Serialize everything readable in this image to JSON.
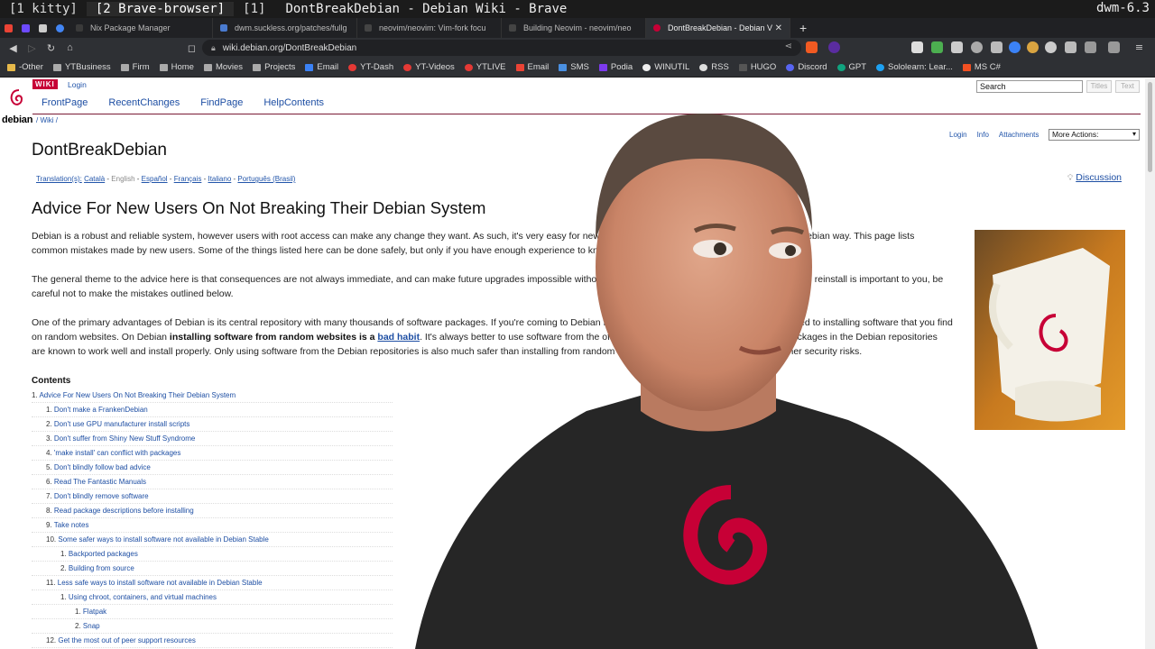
{
  "wm": {
    "tags": [
      "[1 kitty]",
      "[2 Brave-browser]",
      "[1]"
    ],
    "window_title": "DontBreakDebian - Debian Wiki - Brave",
    "status": "dwm-6.3"
  },
  "browser": {
    "tabs": [
      {
        "label": "Nix Package Manager"
      },
      {
        "label": "dwm.suckless.org/patches/fullg"
      },
      {
        "label": "neovim/neovim: Vim-fork focu"
      },
      {
        "label": "Building Neovim - neovim/neo"
      },
      {
        "label": "DontBreakDebian - Debian V",
        "active": true
      }
    ],
    "close_glyph": "✕",
    "newtab_glyph": "+",
    "url": "wiki.debian.org/DontBreakDebian",
    "shield_count": "3",
    "bookmarks": [
      {
        "label": "-Other",
        "color": "#e6b94a"
      },
      {
        "label": "YTBusiness",
        "color": "#aaaaaa"
      },
      {
        "label": "Firm",
        "color": "#aaaaaa"
      },
      {
        "label": "Home",
        "color": "#aaaaaa"
      },
      {
        "label": "Movies",
        "color": "#aaaaaa"
      },
      {
        "label": "Projects",
        "color": "#aaaaaa"
      },
      {
        "label": "Email",
        "color": "#3b82f6"
      },
      {
        "label": "YT-Dash",
        "color": "#e53935"
      },
      {
        "label": "YT-Videos",
        "color": "#e53935"
      },
      {
        "label": "YTLIVE",
        "color": "#e53935"
      },
      {
        "label": "Email",
        "color": "#ea4335"
      },
      {
        "label": "SMS",
        "color": "#4a90e2"
      },
      {
        "label": "Podia",
        "color": "#7c3aed"
      },
      {
        "label": "WINUTIL",
        "color": "#eeeeee"
      },
      {
        "label": "RSS",
        "color": "#dddddd"
      },
      {
        "label": "HUGO",
        "color": "#555555"
      },
      {
        "label": "Discord",
        "color": "#5865f2"
      },
      {
        "label": "GPT",
        "color": "#10a37f"
      },
      {
        "label": "Sololearn: Lear...",
        "color": "#1da1f2"
      },
      {
        "label": "MS C#",
        "color": "#f25022"
      }
    ]
  },
  "wiki": {
    "badge": "WIKI",
    "top_login": "Login",
    "logo_word": "debian",
    "search_placeholder": "Search",
    "titles_btn": "Titles",
    "text_btn": "Text",
    "nav": [
      "FrontPage",
      "RecentChanges",
      "FindPage",
      "HelpContents"
    ],
    "breadcrumb": "/  Wiki /",
    "actions": [
      "Login",
      "Info",
      "Attachments"
    ],
    "more_actions": "More Actions:",
    "page_title": "DontBreakDebian",
    "translations_label": "Translation(s):",
    "translations": [
      "Català",
      "English",
      "Español",
      "Français",
      "Italiano",
      "Português (Brasil)"
    ],
    "discussion": "Discussion",
    "heading": "Advice For New Users On Not Breaking Their Debian System",
    "p1a": "Debian is a robust and reliable system, however users with root access can make any change they want. As such, it's very easy for new",
    "p1b": "s the Debian way. This page lists",
    "p1c": "common mistakes made by new users. Some of the things listed here can be done safely, but only if you have enough experience to kno",
    "p2a": "The general theme to the advice here is that consequences are not always immediate, and can make future upgrades impossible witho",
    "p2b": "plete reinstall is important to you, be",
    "p2c": "careful not to make the mistakes outlined below.",
    "p3a": "One of the primary advantages of Debian is its central repository with many thousands of software packages. If you're coming to Debian fr",
    "p3b": "sed to installing software that you find",
    "p3c": "on random websites. On Debian ",
    "p3d": "installing software from random websites is a",
    "p3e": "bad habit",
    "p3f": ". It's always better to use software from the official D",
    "p3g": "e packages in the Debian repositories",
    "p3h": "are known to work well and install properly. Only using software from the Debian repositories is also much safer than installing from random webs",
    "p3i": "other security risks.",
    "contents_heading": "Contents",
    "toc": [
      {
        "num": "1.",
        "text": "Advice For New Users On Not Breaking Their Debian System",
        "level": 0
      },
      {
        "num": "1.",
        "text": "Don't make a FrankenDebian",
        "level": 1
      },
      {
        "num": "2.",
        "text": "Don't use GPU manufacturer install scripts",
        "level": 1
      },
      {
        "num": "3.",
        "text": "Don't suffer from Shiny New Stuff Syndrome",
        "level": 1
      },
      {
        "num": "4.",
        "text": "'make install' can conflict with packages",
        "level": 1
      },
      {
        "num": "5.",
        "text": "Don't blindly follow bad advice",
        "level": 1
      },
      {
        "num": "6.",
        "text": "Read The Fantastic Manuals",
        "level": 1
      },
      {
        "num": "7.",
        "text": "Don't blindly remove software",
        "level": 1
      },
      {
        "num": "8.",
        "text": "Read package descriptions before installing",
        "level": 1
      },
      {
        "num": "9.",
        "text": "Take notes",
        "level": 1
      },
      {
        "num": "10.",
        "text": "Some safer ways to install software not available in Debian Stable",
        "level": 1
      },
      {
        "num": "1.",
        "text": "Backported packages",
        "level": 2
      },
      {
        "num": "2.",
        "text": "Building from source",
        "level": 2
      },
      {
        "num": "11.",
        "text": "Less safe ways to install software not available in Debian Stable",
        "level": 1
      },
      {
        "num": "1.",
        "text": "Using chroot, containers, and virtual machines",
        "level": 2
      },
      {
        "num": "1.",
        "text": "Flatpak",
        "level": 3
      },
      {
        "num": "2.",
        "text": "Snap",
        "level": 3
      },
      {
        "num": "12.",
        "text": "Get the most out of peer support resources",
        "level": 1
      }
    ]
  },
  "colors": {
    "debian_red": "#c70036",
    "link_blue": "#1d4ea3",
    "shirt": "#262626"
  }
}
